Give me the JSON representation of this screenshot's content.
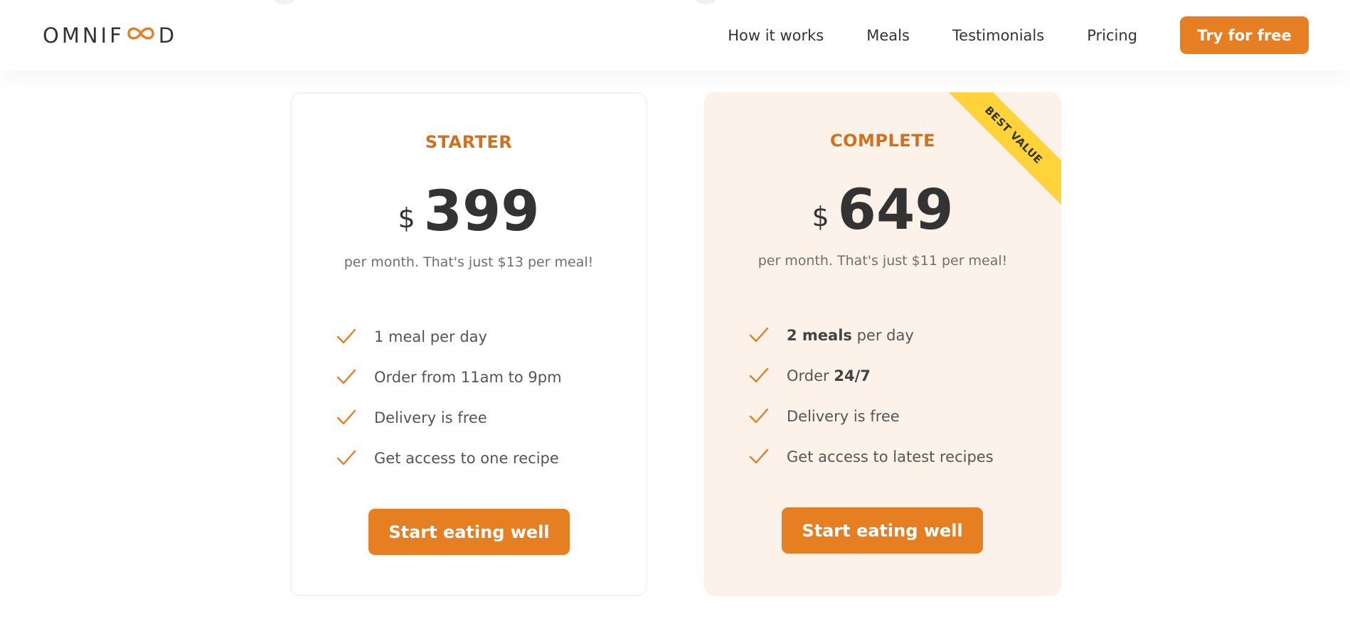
{
  "header": {
    "logo": {
      "prefix": "OMNIF",
      "suffix": "D",
      "icon": "infinity-icon",
      "accent_color": "#e67e22"
    },
    "nav": [
      {
        "label": "How it works"
      },
      {
        "label": "Meals"
      },
      {
        "label": "Testimonials"
      },
      {
        "label": "Pricing"
      }
    ],
    "cta_label": "Try for free"
  },
  "pricing": {
    "starter": {
      "name": "STARTER",
      "currency": "$",
      "price": "399",
      "note": "per month. That's just $13 per meal!",
      "features": [
        {
          "text": "1 meal per day"
        },
        {
          "text": "Order from 11am to 9pm"
        },
        {
          "text": "Delivery is free"
        },
        {
          "text": "Get access to one recipe"
        }
      ],
      "button_label": "Start eating well"
    },
    "complete": {
      "name": "COMPLETE",
      "badge": "BEST VALUE",
      "currency": "$",
      "price": "649",
      "note": "per month. That's just $11 per meal!",
      "features": [
        {
          "strong": "2 meals",
          "text": " per day"
        },
        {
          "text": "Order ",
          "strong": "24/7"
        },
        {
          "text": "Delivery is free"
        },
        {
          "text": "Get access to latest recipes"
        }
      ],
      "button_label": "Start eating well"
    }
  },
  "colors": {
    "primary": "#e67e22",
    "plan_name": "#cf711f",
    "card_tint": "#fdf2e9",
    "badge": "#ffd43b",
    "text_dark": "#333333"
  },
  "icons": {
    "feature": "checkmark-icon"
  }
}
